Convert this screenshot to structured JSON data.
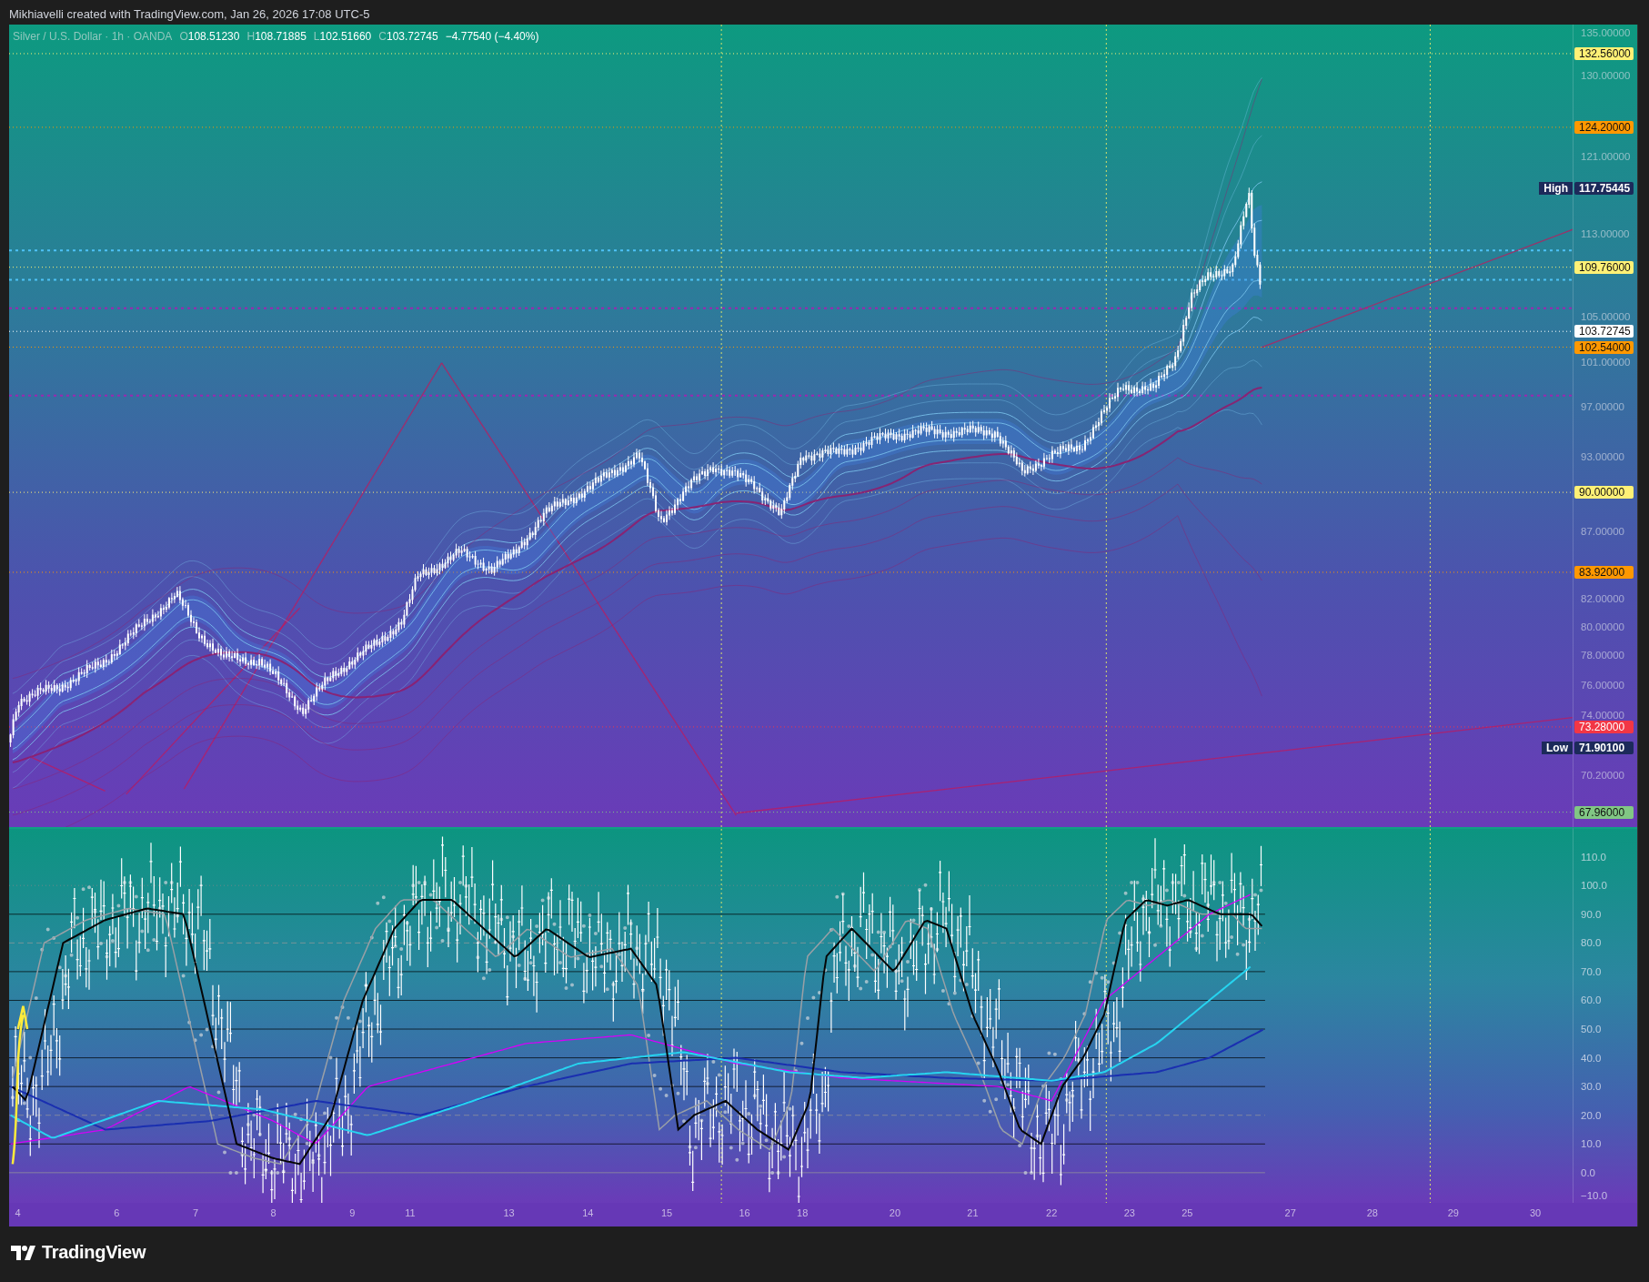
{
  "header": {
    "attribution": "Mikhiavelli created with TradingView.com, Jan 26, 2026 17:08 UTC-5"
  },
  "legend": {
    "symbol": "Silver / U.S. Dollar · 1h · OANDA",
    "ohlc": [
      {
        "label": "O",
        "value": "108.51230"
      },
      {
        "label": "H",
        "value": "108.71885"
      },
      {
        "label": "L",
        "value": "102.51660"
      },
      {
        "label": "C",
        "value": "103.72745"
      }
    ],
    "change": "−4.77540 (−4.40%)"
  },
  "price_axis": {
    "labels": [
      {
        "kind": "tick",
        "text": "135.00000"
      },
      {
        "kind": "level",
        "text": "132.56000",
        "color": "#fff176"
      },
      {
        "kind": "tick",
        "text": "130.00000"
      },
      {
        "kind": "level",
        "text": "124.20000",
        "color": "#ff9800"
      },
      {
        "kind": "tick",
        "text": "121.00000"
      },
      {
        "kind": "extreme",
        "tag": "High",
        "text": "117.75445",
        "color": "#1c2a5a"
      },
      {
        "kind": "tick",
        "text": "113.00000"
      },
      {
        "kind": "level",
        "text": "109.76000",
        "color": "#fff176"
      },
      {
        "kind": "tick",
        "text": "105.00000"
      },
      {
        "kind": "level",
        "text": "103.72745",
        "color": "#ffffff"
      },
      {
        "kind": "level",
        "text": "102.54000",
        "color": "#ff9800"
      },
      {
        "kind": "tick",
        "text": "101.00000"
      },
      {
        "kind": "tick",
        "text": "97.00000"
      },
      {
        "kind": "tick",
        "text": "93.00000"
      },
      {
        "kind": "level",
        "text": "90.00000",
        "color": "#fff176"
      },
      {
        "kind": "tick",
        "text": "87.00000"
      },
      {
        "kind": "level",
        "text": "83.92000",
        "color": "#ff9800"
      },
      {
        "kind": "tick",
        "text": "82.00000"
      },
      {
        "kind": "tick",
        "text": "80.00000"
      },
      {
        "kind": "tick",
        "text": "78.00000"
      },
      {
        "kind": "tick",
        "text": "76.00000"
      },
      {
        "kind": "tick",
        "text": "74.00000"
      },
      {
        "kind": "level",
        "text": "73.28000",
        "color": "#f23645"
      },
      {
        "kind": "extreme",
        "tag": "Low",
        "text": "71.90100",
        "color": "#1c2a5a"
      },
      {
        "kind": "tick",
        "text": "70.20000"
      },
      {
        "kind": "level",
        "text": "67.96000",
        "color": "#81c784"
      }
    ]
  },
  "oscillator_axis": {
    "labels": [
      "110.0",
      "100.0",
      "90.0",
      "80.0",
      "70.0",
      "60.0",
      "50.0",
      "40.0",
      "30.0",
      "20.0",
      "10.0",
      "0.0",
      "−10.0"
    ]
  },
  "time_axis": {
    "labels": [
      "4",
      "6",
      "7",
      "8",
      "9",
      "11",
      "13",
      "14",
      "15",
      "16",
      "18",
      "20",
      "21",
      "22",
      "23",
      "25",
      "27",
      "28",
      "29",
      "30"
    ]
  },
  "footer": {
    "brand": "TradingView"
  }
}
